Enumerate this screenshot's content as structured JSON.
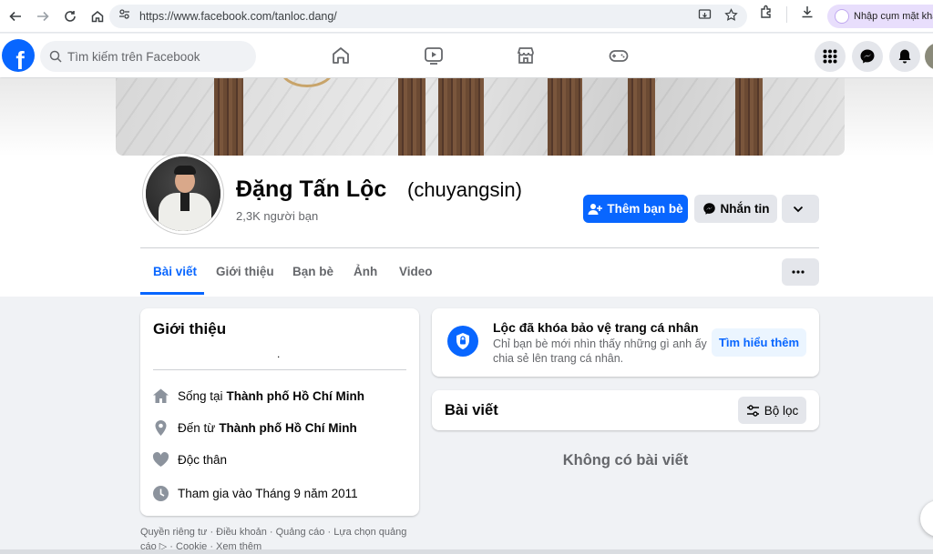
{
  "browser": {
    "url": "https://www.facebook.com/tanloc.dang/",
    "lens_label": "Nhập cụm mặt khẩu"
  },
  "header": {
    "search_placeholder": "Tìm kiếm trên Facebook"
  },
  "profile": {
    "name": "Đặng Tấn Lộc",
    "alt_name": "(chuyangsin)",
    "friends": "2,3K người bạn",
    "add_friend_label": "Thêm bạn bè",
    "message_label": "Nhắn tin"
  },
  "tabs": [
    {
      "label": "Bài viết",
      "active": true
    },
    {
      "label": "Giới thiệu",
      "active": false
    },
    {
      "label": "Bạn bè",
      "active": false
    },
    {
      "label": "Ảnh",
      "active": false
    },
    {
      "label": "Video",
      "active": false
    }
  ],
  "intro": {
    "title": "Giới thiệu",
    "bio": ".",
    "lives_prefix": "Sống tại",
    "lives_place": "Thành phố Hồ Chí Minh",
    "from_prefix": "Đến từ",
    "from_place": "Thành phố Hồ Chí Minh",
    "relationship": "Độc thân",
    "joined": "Tham gia vào Tháng 9 năm 2011"
  },
  "footer": {
    "links": "Quyền riêng tư · Điều khoản · Quảng cáo · Lựa chọn quảng cáo ▷ · Cookie · Xem thêm"
  },
  "locked": {
    "title": "Lộc đã khóa bảo vệ trang cá nhân",
    "desc": "Chỉ bạn bè mới nhìn thấy những gì anh ấy chia sẻ lên trang cá nhân.",
    "learn_more": "Tìm hiểu thêm"
  },
  "posts": {
    "title": "Bài viết",
    "filter_label": "Bộ lọc",
    "empty": "Không có bài viết"
  },
  "colors": {
    "brand": "#0866ff",
    "secondary_text": "#65676b",
    "background": "#f0f2f5"
  }
}
